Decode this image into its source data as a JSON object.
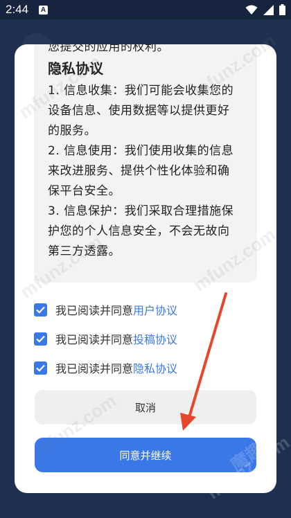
{
  "status_bar": {
    "time": "2:44",
    "notification_letter": "A",
    "icons": [
      "wifi-icon",
      "signal-icon",
      "battery-icon"
    ]
  },
  "terms": {
    "intro_tail": "您提交的应用的权利。",
    "privacy_heading": "隐私协议",
    "lines": [
      "1. 信息收集：我们可能会收集您的",
      "设备信息、使用数据等以提供更好",
      "的服务。",
      "2. 信息使用：我们使用收集的信息",
      "来改进服务、提供个性化体验和确",
      "保平台安全。",
      "3. 信息保护：我们采取合理措施保",
      "护您的个人信息安全，不会无故向",
      "第三方透露。"
    ]
  },
  "agreements": [
    {
      "prefix": "我已阅读并同意",
      "link": "用户协议",
      "checked": true
    },
    {
      "prefix": "我已阅读并同意",
      "link": "投稿协议",
      "checked": true
    },
    {
      "prefix": "我已阅读并同意",
      "link": "隐私协议",
      "checked": true
    }
  ],
  "buttons": {
    "cancel": "取消",
    "agree": "同意并继续"
  },
  "watermark": {
    "text": "mfunz.com",
    "text_cn": "魔趣"
  },
  "colors": {
    "accent": "#3b78e7",
    "background": "#1f2f4f",
    "arrow": "#e8472d"
  }
}
